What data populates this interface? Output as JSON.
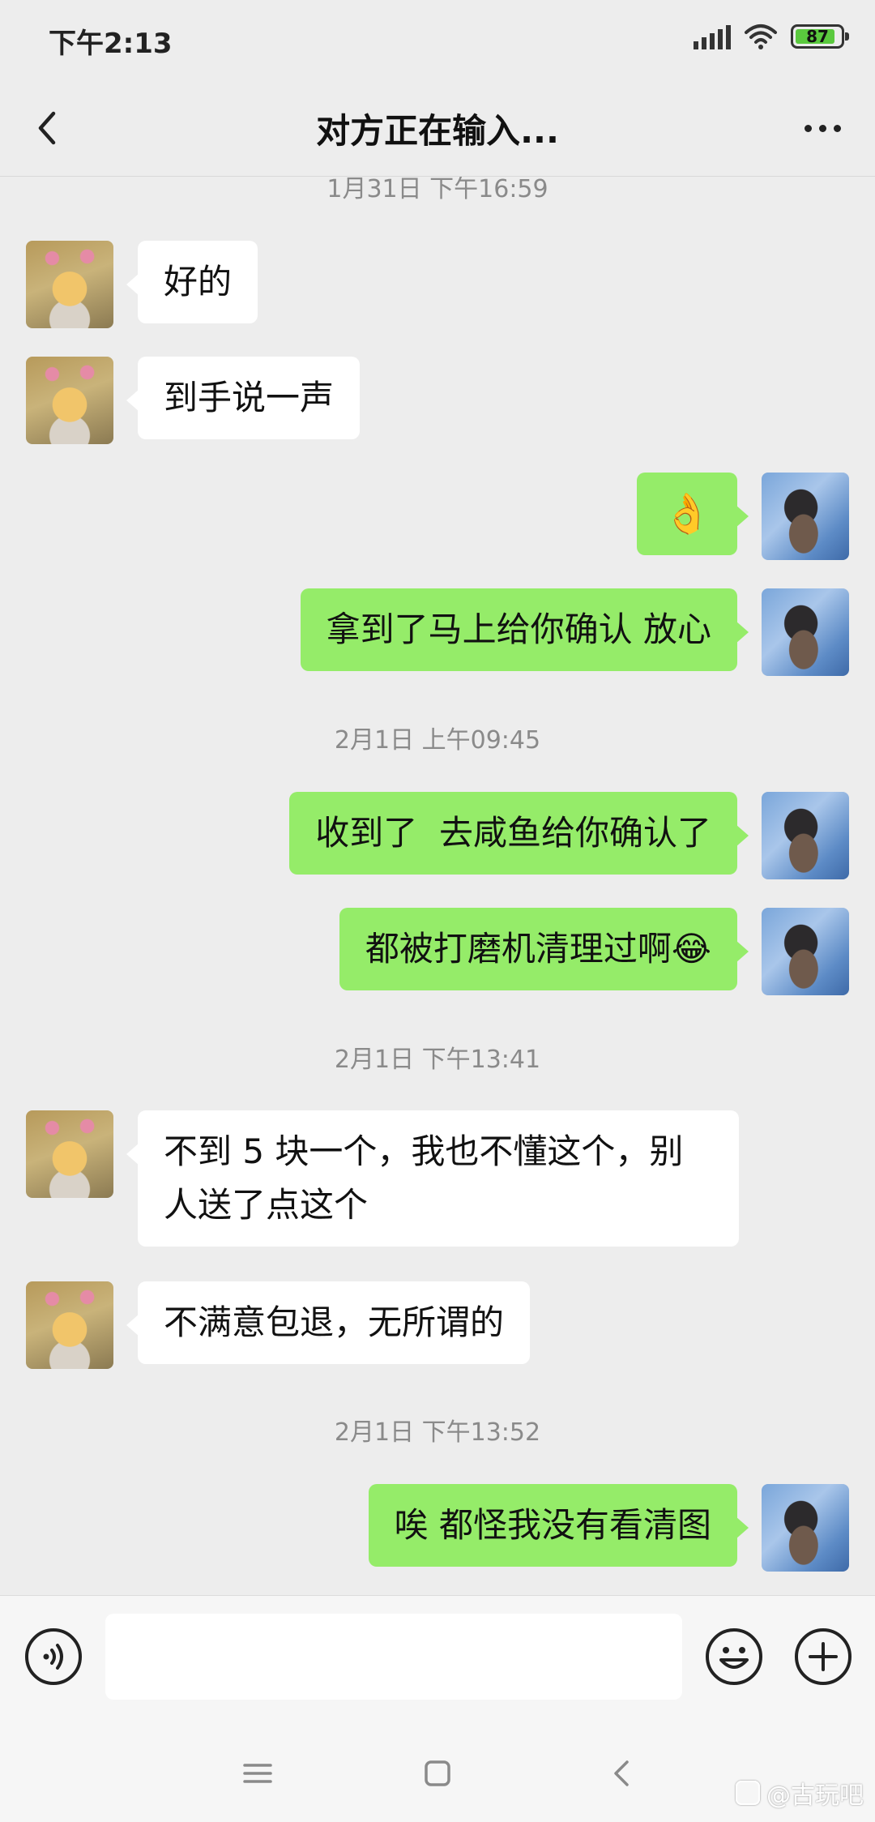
{
  "status_bar": {
    "time": "下午2:13",
    "battery": "87"
  },
  "header": {
    "title": "对方正在输入..."
  },
  "messages": [
    {
      "type": "time",
      "text": "1月31日 下午16:59"
    },
    {
      "type": "peer",
      "text": "好的"
    },
    {
      "type": "peer",
      "text": "到手说一声"
    },
    {
      "type": "self",
      "text": "👌"
    },
    {
      "type": "self",
      "text": "拿到了马上给你确认 放心"
    },
    {
      "type": "time",
      "text": "2月1日 上午09:45"
    },
    {
      "type": "self",
      "text": "收到了  去咸鱼给你确认了"
    },
    {
      "type": "self",
      "text": "都被打磨机清理过啊😂"
    },
    {
      "type": "time",
      "text": "2月1日 下午13:41"
    },
    {
      "type": "peer",
      "text": "不到 5 块一个，我也不懂这个，别人送了点这个"
    },
    {
      "type": "peer",
      "text": "不满意包退，无所谓的"
    },
    {
      "type": "time",
      "text": "2月1日 下午13:52"
    },
    {
      "type": "self",
      "text": "唉 都怪我没有看清图"
    }
  ],
  "input": {
    "value": ""
  },
  "watermark": "@古玩吧"
}
